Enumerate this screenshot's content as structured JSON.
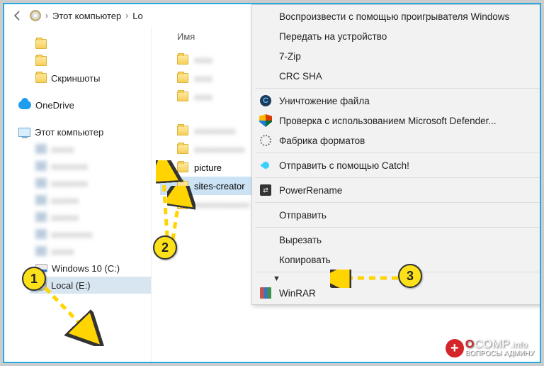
{
  "breadcrumb": {
    "item1": "Этот компьютер",
    "item2_trunc": "Lo",
    "sep": "›"
  },
  "sidebar": {
    "items": [
      {
        "label": "",
        "type": "folder",
        "blur": true
      },
      {
        "label": "",
        "type": "folder",
        "blur": true
      },
      {
        "label": "Скриншоты",
        "type": "folder",
        "blur": false
      },
      {
        "label": "OneDrive",
        "type": "onedrive",
        "blur": false,
        "section": true
      },
      {
        "label": "Этот компьютер",
        "type": "pc",
        "blur": false,
        "section": true
      },
      {
        "label": "",
        "type": "generic",
        "blur": true
      },
      {
        "label": "",
        "type": "generic",
        "blur": true
      },
      {
        "label": "",
        "type": "generic",
        "blur": true
      },
      {
        "label": "",
        "type": "generic",
        "blur": true
      },
      {
        "label": "",
        "type": "generic",
        "blur": true
      },
      {
        "label": "",
        "type": "generic",
        "blur": true
      },
      {
        "label": "",
        "type": "generic",
        "blur": true
      },
      {
        "label": "Windows 10 (C:)",
        "type": "drive",
        "blur": false
      },
      {
        "label": "Local (E:)",
        "type": "dvd",
        "blur": false,
        "selected": true
      }
    ]
  },
  "filelist": {
    "header_name": "Имя",
    "rows": [
      {
        "label": "",
        "blur": true
      },
      {
        "label": "",
        "blur": true
      },
      {
        "label": "",
        "blur": true
      },
      {
        "label": "",
        "blur": true
      },
      {
        "label": "",
        "blur": true
      },
      {
        "label": "picture",
        "blur": false
      },
      {
        "label": "sites-creator",
        "blur": false,
        "selected": true
      },
      {
        "label": "",
        "blur": true
      }
    ]
  },
  "context_menu": {
    "items": [
      {
        "kind": "item",
        "label": "Воспроизвести с помощью проигрывателя Windows",
        "icon": ""
      },
      {
        "kind": "item",
        "label": "Передать на устройство",
        "icon": "",
        "submenu": true
      },
      {
        "kind": "item",
        "label": "7-Zip",
        "icon": "",
        "submenu": true
      },
      {
        "kind": "item",
        "label": "CRC SHA",
        "icon": "",
        "submenu": true
      },
      {
        "kind": "sep"
      },
      {
        "kind": "item",
        "label": "Уничтожение файла",
        "icon": "circle-dark"
      },
      {
        "kind": "item",
        "label": "Проверка с использованием Microsoft Defender...",
        "icon": "defender"
      },
      {
        "kind": "item",
        "label": "Фабрика форматов",
        "icon": "gear",
        "submenu": true
      },
      {
        "kind": "sep"
      },
      {
        "kind": "item",
        "label": "Отправить с помощью Catch!",
        "icon": "dot-cyan"
      },
      {
        "kind": "sep"
      },
      {
        "kind": "item",
        "label": "PowerRename",
        "icon": "badge-pr"
      },
      {
        "kind": "sep"
      },
      {
        "kind": "item",
        "label": "Отправить",
        "icon": "",
        "submenu": true
      },
      {
        "kind": "sep"
      },
      {
        "kind": "item",
        "label": "Вырезать",
        "icon": ""
      },
      {
        "kind": "item",
        "label": "Копировать",
        "icon": ""
      },
      {
        "kind": "sep"
      },
      {
        "kind": "expand-chevron"
      },
      {
        "kind": "item",
        "label": "WinRAR",
        "icon": "books",
        "submenu": true
      }
    ]
  },
  "annotations": {
    "m1": "1",
    "m2": "2",
    "m3": "3"
  },
  "watermark": {
    "plus": "+",
    "brand_a": "O",
    "brand_b": "COMP",
    "brand_dot": ".info",
    "tagline": "вопросы админу"
  }
}
